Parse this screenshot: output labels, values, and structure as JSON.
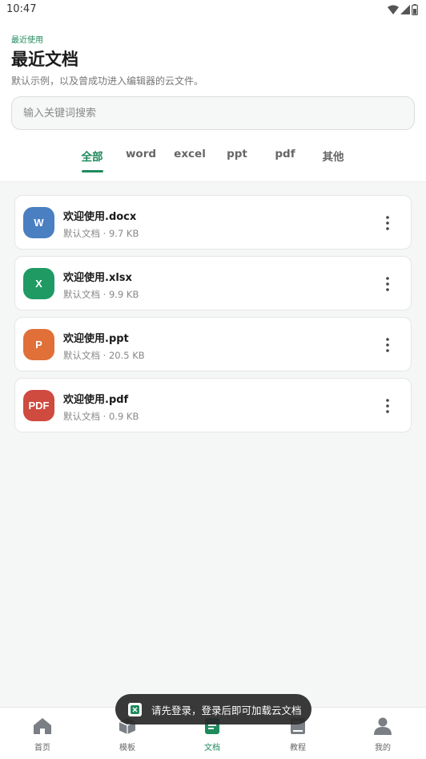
{
  "status_bar": {
    "time": "10:47",
    "icons": [
      "wifi-icon",
      "signal-icon",
      "battery-icon"
    ]
  },
  "header": {
    "eyebrow": "最近使用",
    "title": "最近文档",
    "subtitle": "默认示例，以及曾成功进入编辑器的云文件。"
  },
  "search": {
    "placeholder": "输入关键词搜索",
    "value": ""
  },
  "tabs": [
    {
      "label": "全部",
      "active": true
    },
    {
      "label": "word",
      "active": false
    },
    {
      "label": "excel",
      "active": false
    },
    {
      "label": "ppt",
      "active": false
    },
    {
      "label": "pdf",
      "active": false
    },
    {
      "label": "其他",
      "active": false
    }
  ],
  "files": [
    {
      "icon_label": "W",
      "icon_color": "#4a7fc1",
      "name": "欢迎使用.docx",
      "meta": "默认文档 · 9.7 KB"
    },
    {
      "icon_label": "X",
      "icon_color": "#1f9a63",
      "name": "欢迎使用.xlsx",
      "meta": "默认文档 · 9.9 KB"
    },
    {
      "icon_label": "P",
      "icon_color": "#e07038",
      "name": "欢迎使用.ppt",
      "meta": "默认文档 · 20.5 KB"
    },
    {
      "icon_label": "PDF",
      "icon_color": "#cf4a3f",
      "name": "欢迎使用.pdf",
      "meta": "默认文档 · 0.9 KB"
    }
  ],
  "toast": {
    "text": "请先登录，登录后即可加载云文档",
    "icon": "app-logo-icon"
  },
  "bottom_nav": [
    {
      "label": "首页",
      "icon": "home-icon",
      "active": false
    },
    {
      "label": "模板",
      "icon": "template-icon",
      "active": false
    },
    {
      "label": "文档",
      "icon": "document-icon",
      "active": true
    },
    {
      "label": "教程",
      "icon": "tutorial-icon",
      "active": false
    },
    {
      "label": "我的",
      "icon": "profile-icon",
      "active": false
    }
  ],
  "colors": {
    "accent": "#1f8a5c",
    "background": "#f5f6f6",
    "card": "#ffffff"
  }
}
